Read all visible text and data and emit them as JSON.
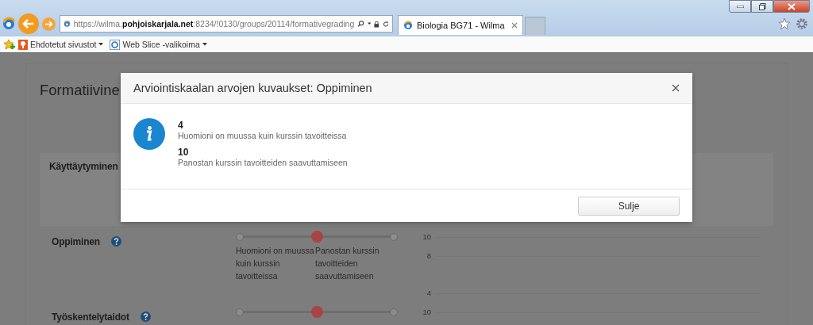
{
  "browser": {
    "address": "https://wilma.**pohjoiskarjala.net**:8234/!0130/groups/20114/formativegrading",
    "tab": {
      "title": "Biologia BG71 - Wilma"
    },
    "favorites": [
      "Ehdotetut sivustot",
      "Web Slice -valikoima"
    ]
  },
  "page": {
    "title": "Formatiivine",
    "sections": [
      {
        "kind": "box",
        "title": "Käyttäytyminen"
      },
      {
        "kind": "slider",
        "title": "Oppiminen",
        "level": 0.5,
        "scale_labels": [
          "Huomioni on muussa kuin kurssin tavoitteissa",
          "Panostan kurssin tavoitteiden saavuttamiseen"
        ],
        "axis_ticks": [
          "10",
          "8",
          "4"
        ]
      },
      {
        "kind": "slider",
        "title": "Työskentelytaidot",
        "level": 0.5,
        "axis_ticks": [
          "10"
        ]
      }
    ]
  },
  "dialog": {
    "title": "Arviointiskaalan arvojen kuvaukset: Oppiminen",
    "entries": [
      {
        "value": "4",
        "description": "Huomioni on muussa kuin kurssin tavoitteissa"
      },
      {
        "value": "10",
        "description": "Panostan kurssin tavoitteiden saavuttamiseen"
      }
    ],
    "buttons": [
      "Sulje"
    ]
  }
}
